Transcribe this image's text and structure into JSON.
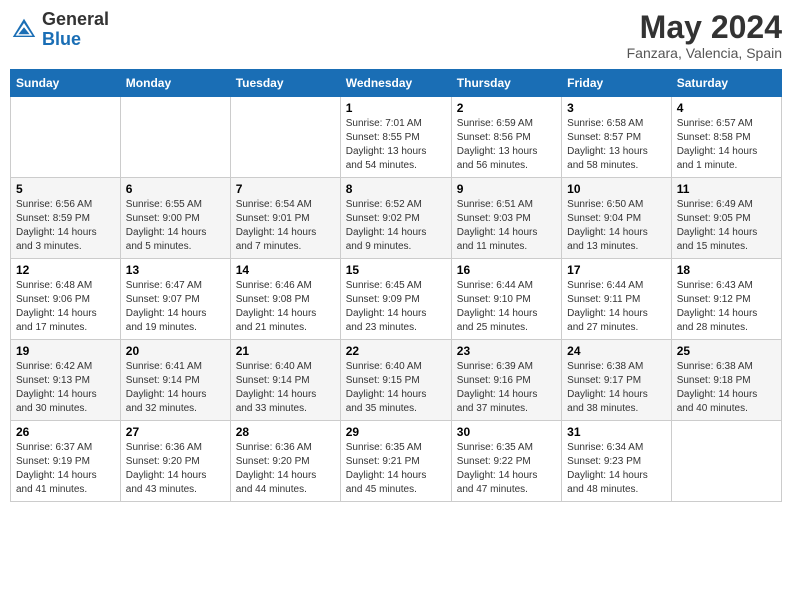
{
  "header": {
    "logo_general": "General",
    "logo_blue": "Blue",
    "month_year": "May 2024",
    "location": "Fanzara, Valencia, Spain"
  },
  "days_of_week": [
    "Sunday",
    "Monday",
    "Tuesday",
    "Wednesday",
    "Thursday",
    "Friday",
    "Saturday"
  ],
  "weeks": [
    [
      {
        "day": "",
        "info": ""
      },
      {
        "day": "",
        "info": ""
      },
      {
        "day": "",
        "info": ""
      },
      {
        "day": "1",
        "info": "Sunrise: 7:01 AM\nSunset: 8:55 PM\nDaylight: 13 hours and 54 minutes."
      },
      {
        "day": "2",
        "info": "Sunrise: 6:59 AM\nSunset: 8:56 PM\nDaylight: 13 hours and 56 minutes."
      },
      {
        "day": "3",
        "info": "Sunrise: 6:58 AM\nSunset: 8:57 PM\nDaylight: 13 hours and 58 minutes."
      },
      {
        "day": "4",
        "info": "Sunrise: 6:57 AM\nSunset: 8:58 PM\nDaylight: 14 hours and 1 minute."
      }
    ],
    [
      {
        "day": "5",
        "info": "Sunrise: 6:56 AM\nSunset: 8:59 PM\nDaylight: 14 hours and 3 minutes."
      },
      {
        "day": "6",
        "info": "Sunrise: 6:55 AM\nSunset: 9:00 PM\nDaylight: 14 hours and 5 minutes."
      },
      {
        "day": "7",
        "info": "Sunrise: 6:54 AM\nSunset: 9:01 PM\nDaylight: 14 hours and 7 minutes."
      },
      {
        "day": "8",
        "info": "Sunrise: 6:52 AM\nSunset: 9:02 PM\nDaylight: 14 hours and 9 minutes."
      },
      {
        "day": "9",
        "info": "Sunrise: 6:51 AM\nSunset: 9:03 PM\nDaylight: 14 hours and 11 minutes."
      },
      {
        "day": "10",
        "info": "Sunrise: 6:50 AM\nSunset: 9:04 PM\nDaylight: 14 hours and 13 minutes."
      },
      {
        "day": "11",
        "info": "Sunrise: 6:49 AM\nSunset: 9:05 PM\nDaylight: 14 hours and 15 minutes."
      }
    ],
    [
      {
        "day": "12",
        "info": "Sunrise: 6:48 AM\nSunset: 9:06 PM\nDaylight: 14 hours and 17 minutes."
      },
      {
        "day": "13",
        "info": "Sunrise: 6:47 AM\nSunset: 9:07 PM\nDaylight: 14 hours and 19 minutes."
      },
      {
        "day": "14",
        "info": "Sunrise: 6:46 AM\nSunset: 9:08 PM\nDaylight: 14 hours and 21 minutes."
      },
      {
        "day": "15",
        "info": "Sunrise: 6:45 AM\nSunset: 9:09 PM\nDaylight: 14 hours and 23 minutes."
      },
      {
        "day": "16",
        "info": "Sunrise: 6:44 AM\nSunset: 9:10 PM\nDaylight: 14 hours and 25 minutes."
      },
      {
        "day": "17",
        "info": "Sunrise: 6:44 AM\nSunset: 9:11 PM\nDaylight: 14 hours and 27 minutes."
      },
      {
        "day": "18",
        "info": "Sunrise: 6:43 AM\nSunset: 9:12 PM\nDaylight: 14 hours and 28 minutes."
      }
    ],
    [
      {
        "day": "19",
        "info": "Sunrise: 6:42 AM\nSunset: 9:13 PM\nDaylight: 14 hours and 30 minutes."
      },
      {
        "day": "20",
        "info": "Sunrise: 6:41 AM\nSunset: 9:14 PM\nDaylight: 14 hours and 32 minutes."
      },
      {
        "day": "21",
        "info": "Sunrise: 6:40 AM\nSunset: 9:14 PM\nDaylight: 14 hours and 33 minutes."
      },
      {
        "day": "22",
        "info": "Sunrise: 6:40 AM\nSunset: 9:15 PM\nDaylight: 14 hours and 35 minutes."
      },
      {
        "day": "23",
        "info": "Sunrise: 6:39 AM\nSunset: 9:16 PM\nDaylight: 14 hours and 37 minutes."
      },
      {
        "day": "24",
        "info": "Sunrise: 6:38 AM\nSunset: 9:17 PM\nDaylight: 14 hours and 38 minutes."
      },
      {
        "day": "25",
        "info": "Sunrise: 6:38 AM\nSunset: 9:18 PM\nDaylight: 14 hours and 40 minutes."
      }
    ],
    [
      {
        "day": "26",
        "info": "Sunrise: 6:37 AM\nSunset: 9:19 PM\nDaylight: 14 hours and 41 minutes."
      },
      {
        "day": "27",
        "info": "Sunrise: 6:36 AM\nSunset: 9:20 PM\nDaylight: 14 hours and 43 minutes."
      },
      {
        "day": "28",
        "info": "Sunrise: 6:36 AM\nSunset: 9:20 PM\nDaylight: 14 hours and 44 minutes."
      },
      {
        "day": "29",
        "info": "Sunrise: 6:35 AM\nSunset: 9:21 PM\nDaylight: 14 hours and 45 minutes."
      },
      {
        "day": "30",
        "info": "Sunrise: 6:35 AM\nSunset: 9:22 PM\nDaylight: 14 hours and 47 minutes."
      },
      {
        "day": "31",
        "info": "Sunrise: 6:34 AM\nSunset: 9:23 PM\nDaylight: 14 hours and 48 minutes."
      },
      {
        "day": "",
        "info": ""
      }
    ]
  ]
}
